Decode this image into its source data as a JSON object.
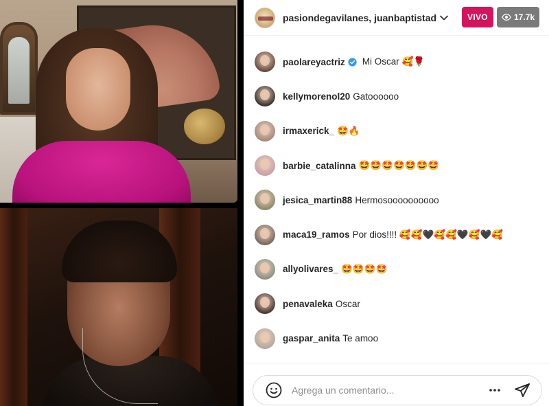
{
  "stream": {
    "hosts_title": "pasiondegavilanes, juanbaptistad",
    "live_label": "VIVO",
    "viewer_count": "17.7k"
  },
  "comments": [
    {
      "user": "paolareyactriz",
      "message": "Mi Oscar 🥰🌹",
      "verified": true,
      "avatar_color": "#6b4d3e"
    },
    {
      "user": "kellymorenol20",
      "message": "Gatoooooo",
      "verified": false,
      "avatar_color": "#3b3530"
    },
    {
      "user": "irmaxerick_",
      "message": "🤩🔥",
      "verified": false,
      "avatar_color": "#a78a7a"
    },
    {
      "user": "barbie_catalinna",
      "message": "🤩🤩🤩🤩🤩🤩🤩",
      "verified": false,
      "avatar_color": "#c9a1a6"
    },
    {
      "user": "jesica_martin88",
      "message": "Hermosoooooooooo",
      "verified": false,
      "avatar_color": "#8e8a6c"
    },
    {
      "user": "maca19_ramos",
      "message": "Por dios!!!! 🥰🥰🖤🥰🥰🖤🥰🖤🥰",
      "verified": false,
      "avatar_color": "#7c6a5e"
    },
    {
      "user": "allyolivares_",
      "message": "🤩🤩🤩🤩",
      "verified": false,
      "avatar_color": "#8d9283"
    },
    {
      "user": "penavaleka",
      "message": "Oscar",
      "verified": false,
      "avatar_color": "#4e3a35"
    },
    {
      "user": "gaspar_anita",
      "message": "Te amoo",
      "verified": false,
      "avatar_color": "#b6a89e"
    }
  ],
  "composer": {
    "placeholder": "Agrega un comentario..."
  },
  "icons": {
    "header_avatar": "profile-avatar-icon",
    "chevron": "chevron-down-icon",
    "viewers": "eye-icon",
    "emoji": "smiley-icon",
    "more": "more-options-icon",
    "send": "send-paper-plane-icon",
    "verified": "verified-badge-icon"
  },
  "colors": {
    "live": "#d6145e",
    "viewers_bg": "#7a7a7a",
    "verified": "#3897f0"
  }
}
